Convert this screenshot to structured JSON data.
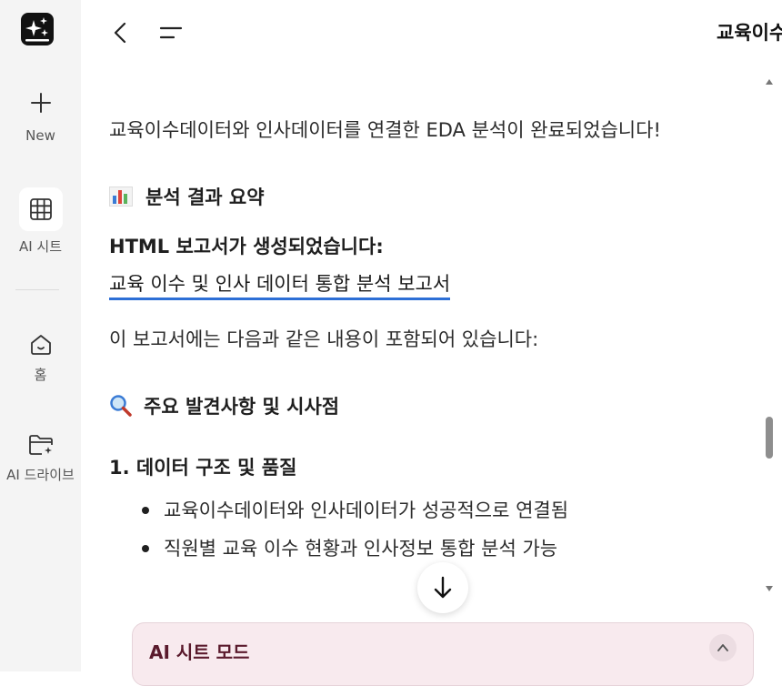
{
  "sidebar": {
    "logo_icon": "sparkles-logo-icon",
    "items": [
      {
        "label": "New",
        "icon": "plus-icon"
      },
      {
        "label": "AI 시트",
        "icon": "grid-table-icon"
      },
      {
        "label": "홈",
        "icon": "home-icon"
      },
      {
        "label": "AI 드라이브",
        "icon": "folder-star-icon"
      }
    ]
  },
  "header": {
    "title": "교육이수",
    "back_icon": "chevron-left-icon",
    "menu_icon": "menu-lines-icon"
  },
  "content": {
    "intro": "교육이수데이터와 인사데이터를 연결한 EDA 분석이 완료되었습니다!",
    "summary_heading": "분석 결과 요약",
    "summary_emoji": "bar-chart-emoji",
    "report_heading": "HTML 보고서가 생성되었습니다:",
    "report_link": "교육 이수 및 인사 데이터 통합 분석 보고서",
    "includes_text": "이 보고서에는 다음과 같은 내용이 포함되어 있습니다:",
    "findings_heading": "주요 발견사항 및 시사점",
    "findings_emoji": "magnifier-emoji",
    "section1_heading": "1. 데이터 구조 및 품질",
    "bullets": [
      "교육이수데이터와 인사데이터가 성공적으로 연결됨",
      "직원별 교육 이수 현황과 인사정보 통합 분석 가능"
    ]
  },
  "mode_panel": {
    "title": "AI 시트 모드",
    "toggle_icon": "chevron-up-icon"
  },
  "colors": {
    "sidebar_bg": "#f4f4f4",
    "link_underline": "#2d6fd6",
    "mode_panel_bg": "#f8eaee",
    "mode_title": "#5a1a2c"
  }
}
